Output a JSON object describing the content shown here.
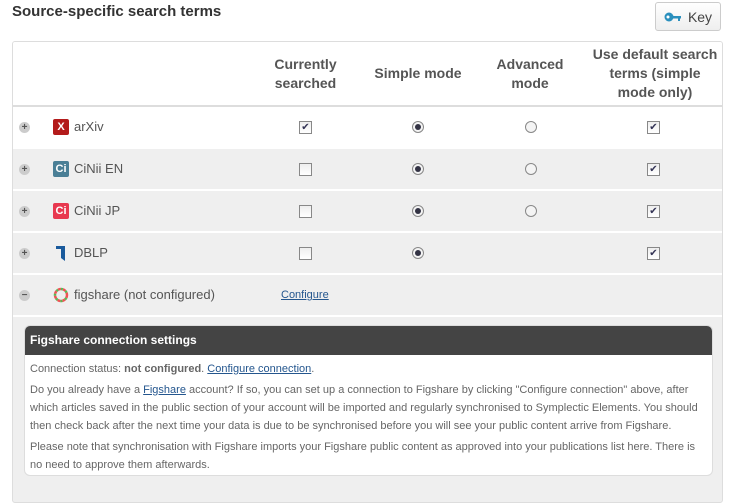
{
  "title": "Source-specific search terms",
  "key_button": {
    "label": "Key",
    "icon": "key-icon"
  },
  "columns": [
    "Currently searched",
    "Simple mode",
    "Advanced mode",
    "Use default search terms (simple mode only)"
  ],
  "rows": [
    {
      "name": "arXiv",
      "logo": "X",
      "color": "#b31b1b",
      "currently": true,
      "simple": true,
      "advanced": false,
      "default": true,
      "has_advanced": true,
      "has_default": true
    },
    {
      "name": "CiNii EN",
      "logo": "Ci",
      "color": "#4a7f96",
      "currently": false,
      "simple": true,
      "advanced": false,
      "default": true,
      "has_advanced": true,
      "has_default": true
    },
    {
      "name": "CiNii JP",
      "logo": "Ci",
      "color": "#e8384f",
      "currently": false,
      "simple": true,
      "advanced": false,
      "default": true,
      "has_advanced": true,
      "has_default": true
    },
    {
      "name": "DBLP",
      "logo": "",
      "color": "#1a5a9c",
      "currently": false,
      "simple": true,
      "advanced": false,
      "default": true,
      "has_advanced": false,
      "has_default": true
    }
  ],
  "figshare": {
    "name": "figshare (not configured)",
    "configure": "Configure"
  },
  "panel": {
    "title": "Figshare connection settings",
    "status_prefix": "Connection status: ",
    "status_value": "not configured",
    "status_sep": ". ",
    "configure_link": "Configure connection",
    "status_end": ".",
    "p1_a": "Do you already have a ",
    "p1_link": "Figshare",
    "p1_b": " account? If so, you can set up a connection to Figshare by clicking \"Configure connection\" above, after which articles saved in the public section of your account will be imported and regularly synchronised to Symplectic Elements. You should then check back after the next time your data is due to be synchronised before you will see your public content arrive from Figshare.",
    "p2": "Please note that synchronisation with Figshare imports your Figshare public content as approved into your publications list here. There is no need to approve them afterwards."
  }
}
